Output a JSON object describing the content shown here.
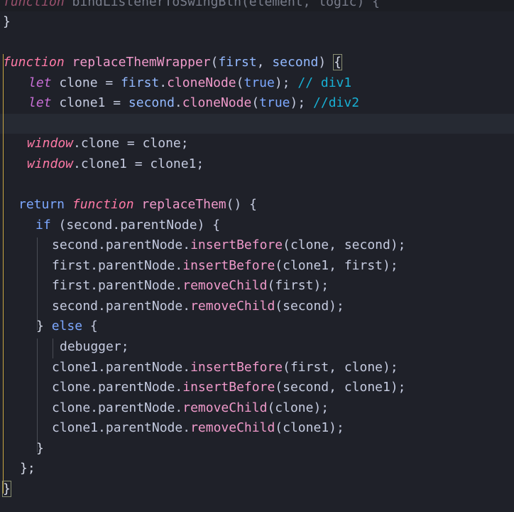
{
  "code": {
    "line_cut": {
      "kw": "function",
      "rest": " bindListenerToSwingBtn(element, logic) {"
    },
    "line_0": "}",
    "line_fn": {
      "kw": "function",
      "name": "replaceThemWrapper",
      "open": "(",
      "p1": "first",
      "sep": ", ",
      "p2": "second",
      "close": ") ",
      "brace": "{"
    },
    "line_let1": {
      "kw": "let",
      "a": " clone = ",
      "b": "first",
      "c": ".",
      "d": "cloneNode",
      "e": "(",
      "f": "true",
      "g": "); ",
      "comment": "// div1"
    },
    "line_let2": {
      "kw": "let",
      "a": " clone1 = ",
      "b": "second",
      "c": ".",
      "d": "cloneNode",
      "e": "(",
      "f": "true",
      "g": "); ",
      "comment": "//div2"
    },
    "line_win1": {
      "kw": "window",
      "rest": ".clone = clone;"
    },
    "line_win2": {
      "kw": "window",
      "rest": ".clone1 = clone1;"
    },
    "line_ret": {
      "kw": "return",
      "kw2": "function",
      "name": "replaceThem",
      "rest": "() {"
    },
    "line_if": {
      "kw": "if",
      "rest": " (second.parentNode) {"
    },
    "line_s1": {
      "a": "second.parentNode.",
      "fn": "insertBefore",
      "b": "(clone, second);"
    },
    "line_s2": {
      "a": "first.parentNode.",
      "fn": "insertBefore",
      "b": "(clone1, first);"
    },
    "line_s3": {
      "a": "first.parentNode.",
      "fn": "removeChild",
      "b": "(first);"
    },
    "line_s4": {
      "a": "second.parentNode.",
      "fn": "removeChild",
      "b": "(second);"
    },
    "line_else": {
      "a": "} ",
      "kw": "else",
      "b": " {"
    },
    "line_dbg": "debugger;",
    "line_e1": {
      "a": "clone1.parentNode.",
      "fn": "insertBefore",
      "b": "(first, clone);"
    },
    "line_e2": {
      "a": "clone.parentNode.",
      "fn": "insertBefore",
      "b": "(second, clone1);"
    },
    "line_e3": {
      "a": "clone.parentNode.",
      "fn": "removeChild",
      "b": "(clone);"
    },
    "line_e4": {
      "a": "clone1.parentNode.",
      "fn": "removeChild",
      "b": "(clone1);"
    },
    "line_close_if": "}",
    "line_close_ret": "};",
    "line_close_fn": "}"
  }
}
